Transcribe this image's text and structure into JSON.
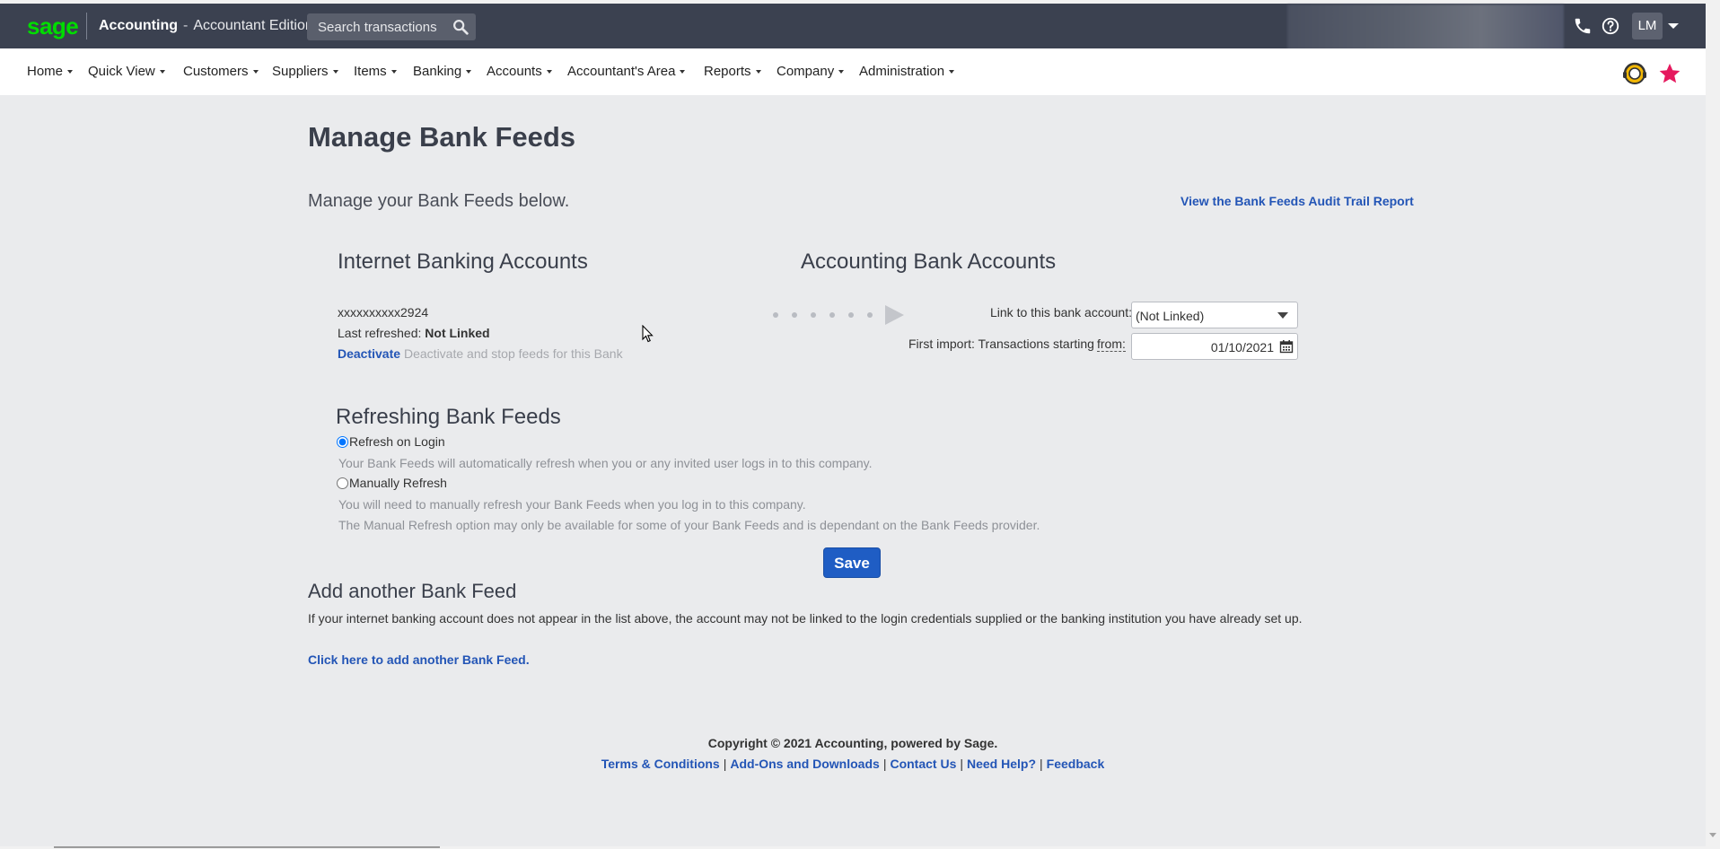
{
  "header": {
    "logo": "sage",
    "app_name": "Accounting",
    "separator": "-",
    "edition": "Accountant Edition",
    "search_placeholder": "Search transactions",
    "user_initials": "LM"
  },
  "nav": {
    "items": [
      "Home",
      "Quick View",
      "Customers",
      "Suppliers",
      "Items",
      "Banking",
      "Accounts",
      "Accountant's Area",
      "Reports",
      "Company",
      "Administration"
    ]
  },
  "page": {
    "title": "Manage Bank Feeds",
    "subtitle": "Manage your Bank Feeds below.",
    "audit_link": "View the Bank Feeds Audit Trail Report"
  },
  "internet_banking": {
    "heading": "Internet Banking Accounts",
    "account_number": "xxxxxxxxxx2924",
    "last_refreshed_label": "Last refreshed:",
    "last_refreshed_value": "Not Linked",
    "deactivate_label": "Deactivate",
    "deactivate_desc": "Deactivate and stop feeds for this Bank"
  },
  "accounting_banking": {
    "heading": "Accounting Bank Accounts",
    "link_label": "Link to this bank account:",
    "link_value": "(Not Linked)",
    "first_import_label": "First import: Transactions starting",
    "from_label": "from:",
    "from_date": "01/10/2021"
  },
  "refreshing": {
    "heading": "Refreshing Bank Feeds",
    "option_login": "Refresh on Login",
    "option_login_selected": true,
    "option_login_help": "Your Bank Feeds will automatically refresh when you or any invited user logs in to this company.",
    "option_manual": "Manually Refresh",
    "option_manual_help": "You will need to manually refresh your Bank Feeds when you log in to this company.",
    "option_manual_note": "The Manual Refresh option may only be available for some of your Bank Feeds and is dependant on the Bank Feeds provider.",
    "save_label": "Save"
  },
  "add_feed": {
    "heading": "Add another Bank Feed",
    "info": "If your internet banking account does not appear in the list above, the account may not be linked to the login credentials supplied or the banking institution you have already set up.",
    "link": "Click here to add another Bank Feed."
  },
  "footer": {
    "copyright": "Copyright © 2021 Accounting, powered by Sage.",
    "links": [
      "Terms & Conditions",
      "Add-Ons and Downloads",
      "Contact Us",
      "Need Help?",
      "Feedback"
    ]
  },
  "colors": {
    "topbar": "#3b4150",
    "brand_green": "#00dc00",
    "link_blue": "#2355b6",
    "save_button": "#1f5dc4",
    "star": "#e5195e"
  },
  "icons": {
    "search": "search-icon",
    "phone": "phone-icon",
    "help": "help-circle-icon",
    "calendar": "calendar-icon",
    "star": "star-icon",
    "support": "support-badge-icon"
  }
}
